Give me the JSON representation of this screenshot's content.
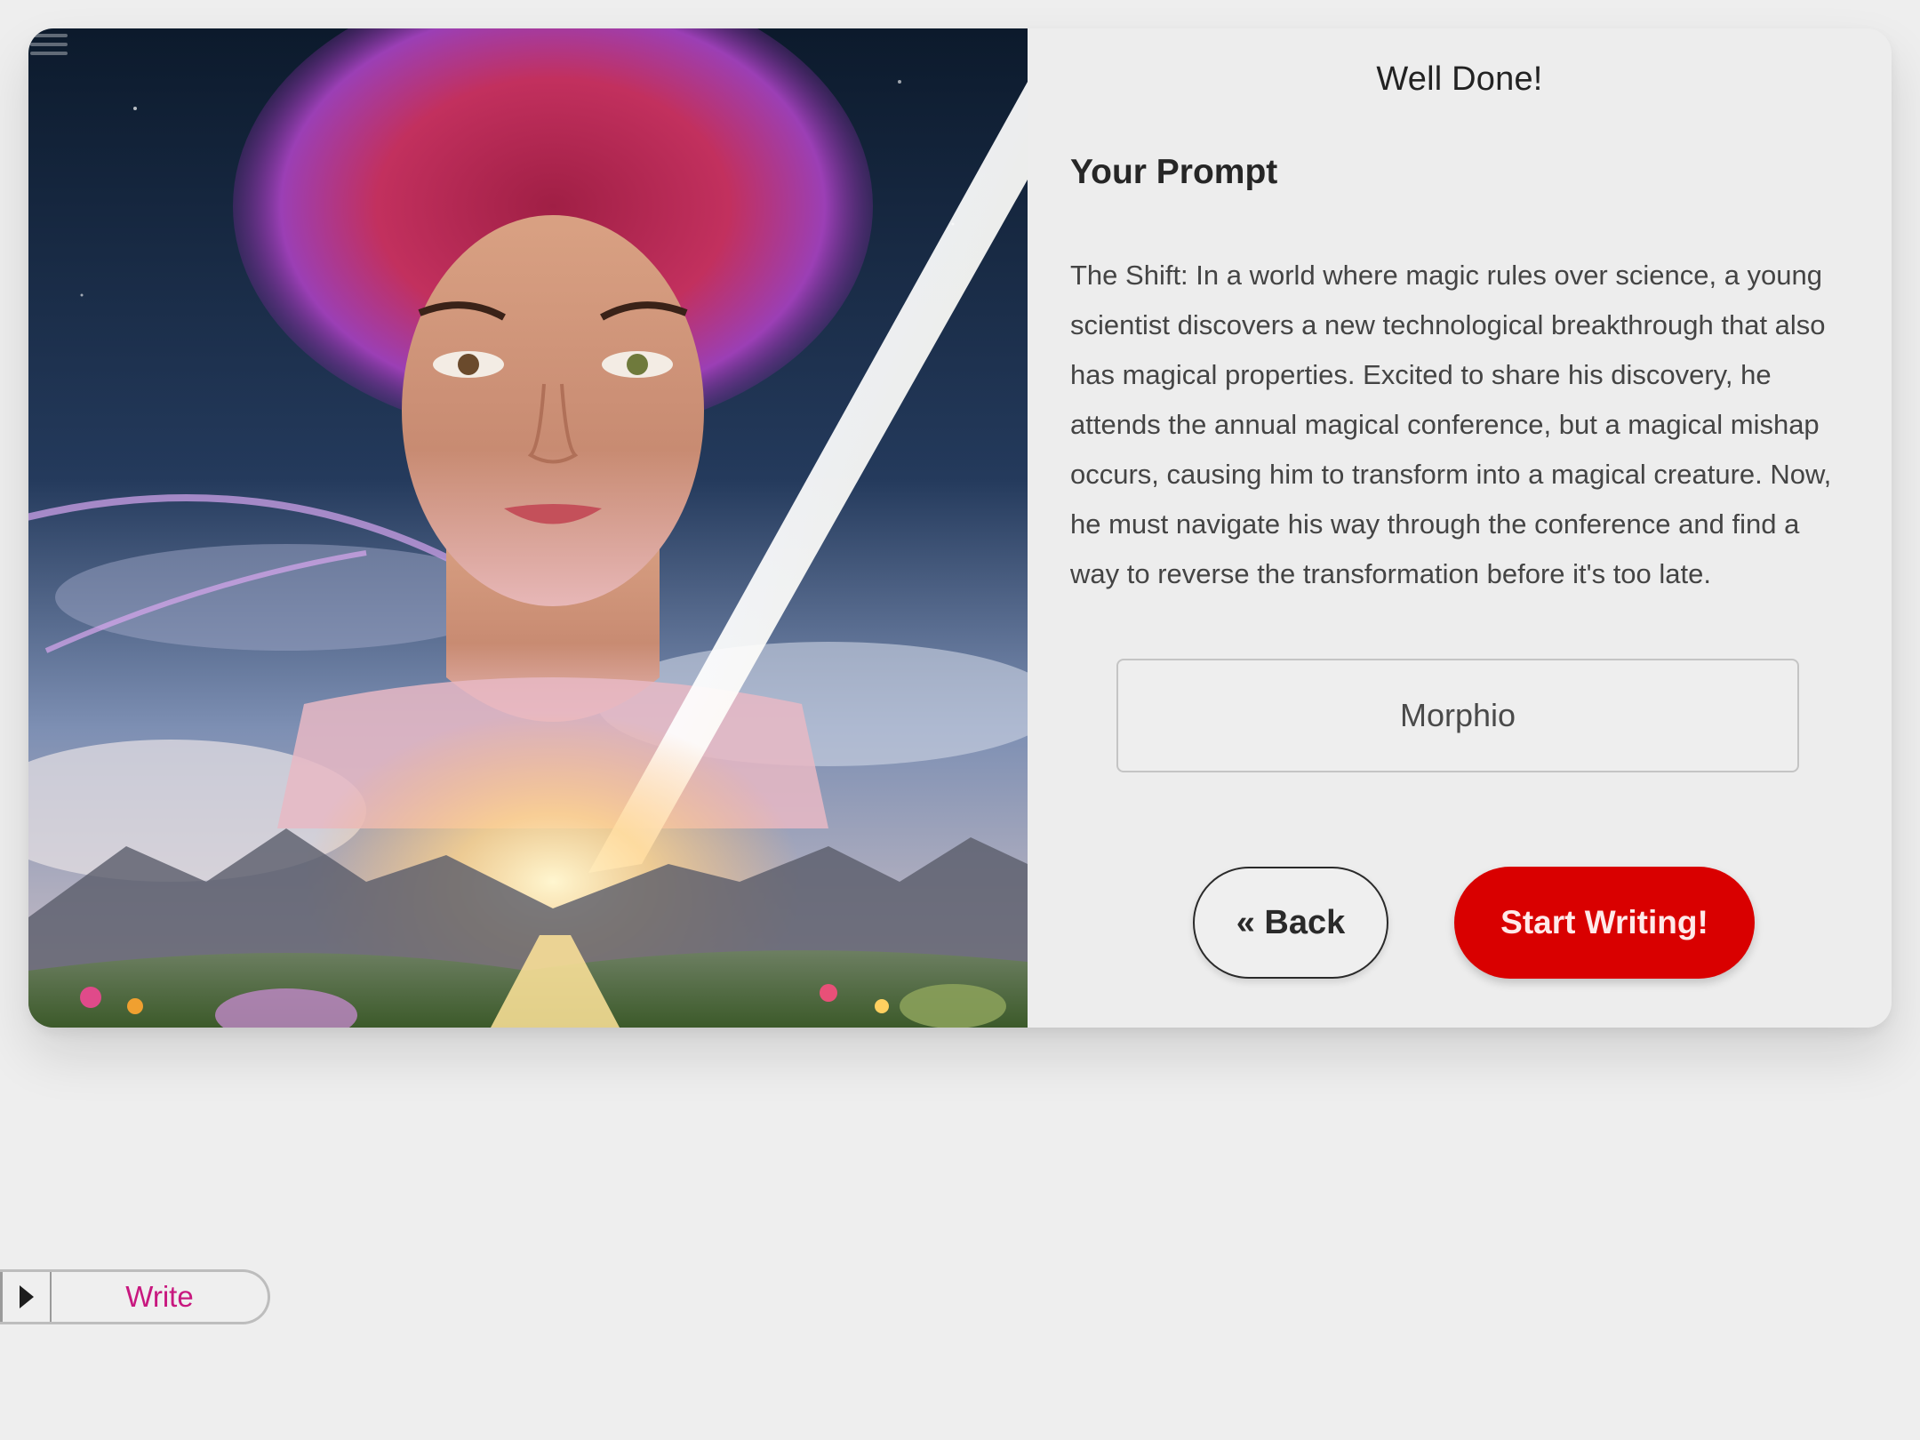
{
  "card": {
    "title": "Well Done!",
    "prompt_heading": "Your Prompt",
    "prompt_text": "The Shift: In a world where magic rules over science, a young scientist discovers a new technological breakthrough that also has magical properties. Excited to share his discovery, he attends the annual magical conference, but a magical mishap occurs, causing him to transform into a magical creature. Now, he must navigate his way through the conference and find a way to reverse the transformation before it's too late.",
    "name_value": "Morphio",
    "back_label": "« Back",
    "start_label": "Start Writing!"
  },
  "write_tab": {
    "label": "Write"
  },
  "colors": {
    "accent": "#d90000",
    "write_label": "#c8187f",
    "background": "#eeeeee"
  },
  "icons": {
    "menu": "menu-icon",
    "play": "play-icon"
  }
}
